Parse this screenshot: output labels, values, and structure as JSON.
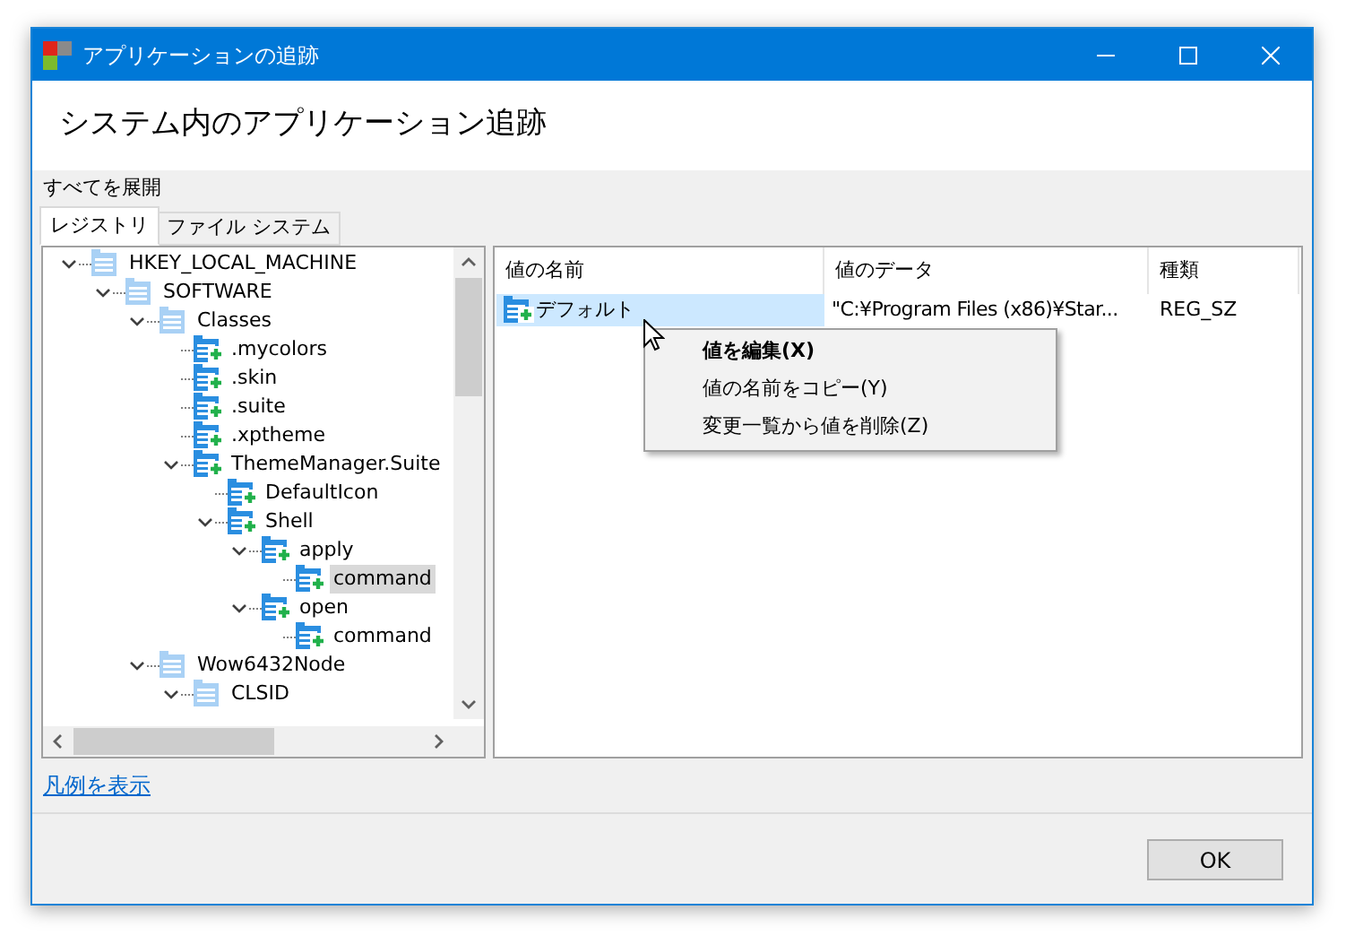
{
  "window": {
    "title": "アプリケーションの追跡"
  },
  "heading": "システム内のアプリケーション追跡",
  "toolbar": {
    "expand_all": "すべてを展開"
  },
  "tabs": [
    {
      "label": "レジストリ",
      "selected": true
    },
    {
      "label": "ファイル システム",
      "selected": false
    }
  ],
  "tree": [
    {
      "label": "HKEY_LOCAL_MACHINE",
      "kind": "plain",
      "expanded": true,
      "selected": false,
      "children": [
        {
          "label": "SOFTWARE",
          "kind": "plain",
          "expanded": true,
          "selected": false,
          "children": [
            {
              "label": "Classes",
              "kind": "plain",
              "expanded": true,
              "selected": false,
              "children": [
                {
                  "label": ".mycolors",
                  "kind": "added",
                  "selected": false
                },
                {
                  "label": ".skin",
                  "kind": "added",
                  "selected": false
                },
                {
                  "label": ".suite",
                  "kind": "added",
                  "selected": false
                },
                {
                  "label": ".xptheme",
                  "kind": "added",
                  "selected": false
                },
                {
                  "label": "ThemeManager.Suite",
                  "kind": "added",
                  "expanded": true,
                  "selected": false,
                  "children": [
                    {
                      "label": "DefaultIcon",
                      "kind": "added",
                      "selected": false
                    },
                    {
                      "label": "Shell",
                      "kind": "added",
                      "expanded": true,
                      "selected": false,
                      "children": [
                        {
                          "label": "apply",
                          "kind": "added",
                          "expanded": true,
                          "selected": false,
                          "children": [
                            {
                              "label": "command",
                              "kind": "added",
                              "selected": true
                            }
                          ]
                        },
                        {
                          "label": "open",
                          "kind": "added",
                          "expanded": true,
                          "selected": false,
                          "children": [
                            {
                              "label": "command",
                              "kind": "added",
                              "selected": false
                            }
                          ]
                        }
                      ]
                    }
                  ]
                }
              ]
            },
            {
              "label": "Wow6432Node",
              "kind": "plain",
              "expanded": true,
              "selected": false,
              "children": [
                {
                  "label": "CLSID",
                  "kind": "plain",
                  "expanded": true,
                  "selected": false
                }
              ]
            }
          ]
        }
      ]
    }
  ],
  "table": {
    "columns": [
      "値の名前",
      "値のデータ",
      "種類"
    ],
    "rows": [
      {
        "name": "デフォルト",
        "data": "\"C:¥Program Files (x86)¥Star...",
        "type": "REG_SZ",
        "selected": true
      }
    ]
  },
  "context_menu": [
    {
      "label": "値を編集(X)",
      "default": true
    },
    {
      "label": "値の名前をコピー(Y)",
      "default": false
    },
    {
      "label": "変更一覧から値を削除(Z)",
      "default": false
    }
  ],
  "legend_link": "凡例を表示",
  "buttons": [
    "OK"
  ]
}
